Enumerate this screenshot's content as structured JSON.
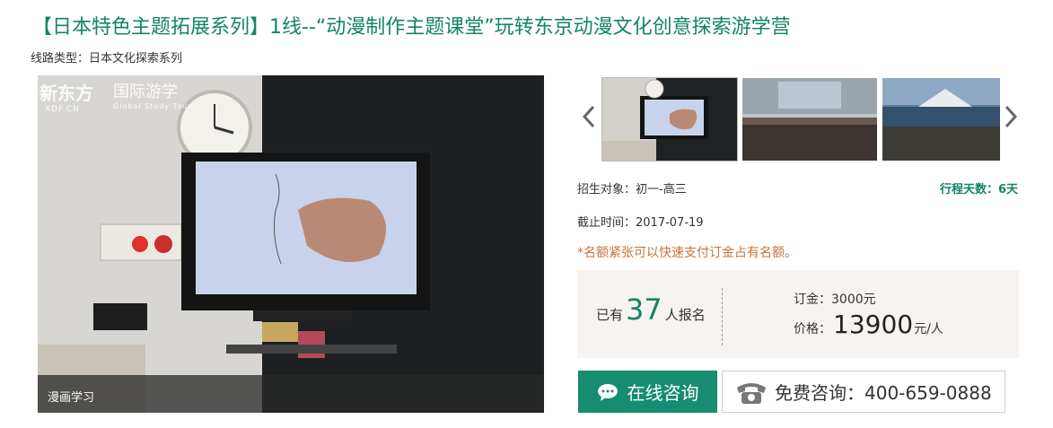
{
  "title": "【日本特色主题拓展系列】1线--“动漫制作主题课堂”玩转东京动漫文化创意探索游学营",
  "route_type": "线路类型：日本文化探索系列",
  "main_image": {
    "logo_brand": "新东方",
    "logo_domain": "XDF.CN",
    "logo_division": "国际游学",
    "logo_division_en": "Global Study Tour",
    "caption": "漫画学习"
  },
  "carousel": {
    "prev_icon": "chevron-left-icon",
    "next_icon": "chevron-right-icon"
  },
  "info": {
    "enrollment_target": "招生对象：初一-高三",
    "trip_days": "行程天数：6天",
    "deadline": "截止时间：2017-07-19",
    "notice": "*名额紧张可以快速支付订金占有名额。"
  },
  "price_box": {
    "signed_prefix": "已有",
    "signed_count": "37",
    "signed_suffix": "人报名",
    "deposit": "订金：3000元",
    "price_label": "价格：",
    "price_value": "13900",
    "price_unit": "元/人"
  },
  "actions": {
    "consult_label": "在线咨询",
    "phone_label": "免费咨询：400-659-0888"
  },
  "colors": {
    "brand_green": "#138468",
    "button_green": "#168c70",
    "notice_orange": "#c9733a",
    "price_box_bg": "#f6f3f0"
  }
}
